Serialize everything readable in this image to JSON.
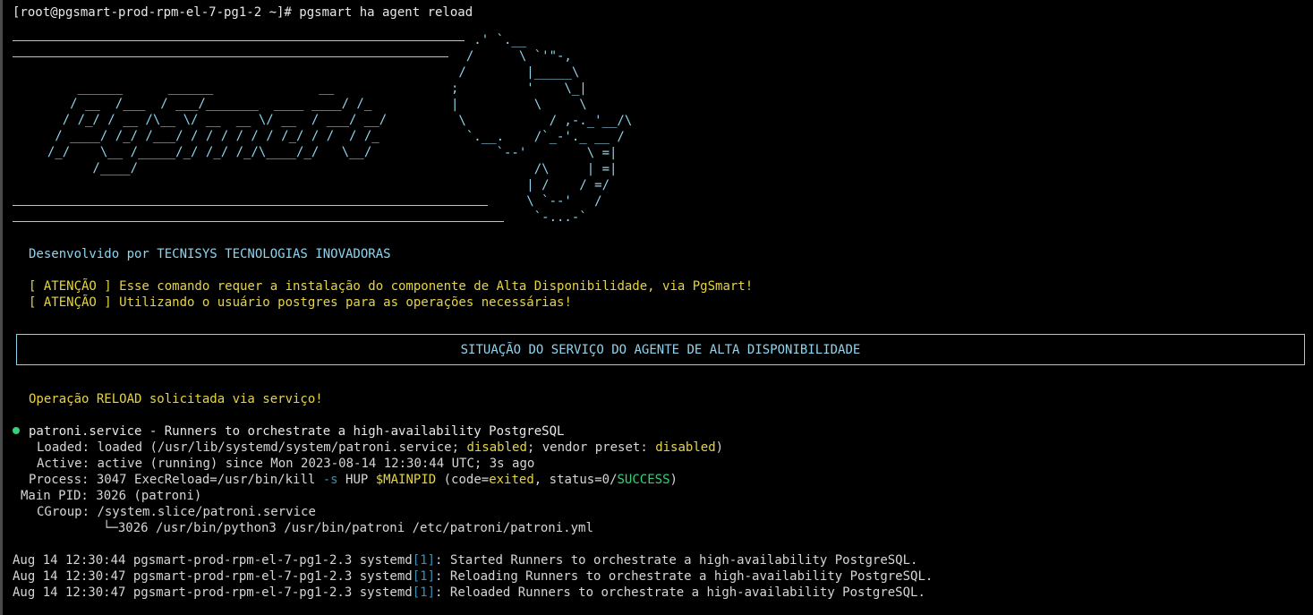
{
  "prompt": {
    "text": "[root@pgsmart-prod-rpm-el-7-pg1-2 ~]# pgsmart ha agent reload"
  },
  "banner": {
    "logo_art": "      ______      ______              __\n     / __  /___  / ___/_______  ____ ____/ /_\n    / /_/ / __ /\\__ \\/ __  __ \\/ __  / ___/ __/\n   / ____/ /_/ /___/ / / / / / / /_/ / /  / /_\n  /_/    \\__ /_____/_/ /_/ /_/\\____/_/   \\__/\n        /____/",
    "mascot_art": "   .' `.__\n  /      \\ `'\"-,\n /        |_____\\\n;         '    \\_|\n|          \\     \\\n \\           / ,-._'__/\\\n  `.__.    /`_-'._ __ /\n      `--'        \\ =|\n           /\\     | =|\n          | /    / =/\n          \\ `--'   /\n           `-...-`"
  },
  "developer_line": "Desenvolvido por TECNISYS TECNOLOGIAS INOVADORAS",
  "warnings": [
    "[ ATENÇÃO ] Esse comando requer a instalação do componente de Alta Disponibilidade, via PgSmart!",
    "[ ATENÇÃO ] Utilizando o usuário postgres para as operações necessárias!"
  ],
  "status_box": {
    "title": "SITUAÇÃO DO SERVIÇO DO AGENTE DE ALTA DISPONIBILIDADE"
  },
  "operation_line": "Operação RELOAD solicitada via serviço!",
  "service": {
    "unit": "patroni.service",
    "description": " - Runners to orchestrate a high-availability PostgreSQL",
    "loaded_label": "Loaded:",
    "loaded_pre": " loaded (/usr/lib/systemd/system/patroni.service; ",
    "loaded_state": "disabled",
    "loaded_mid": "; vendor preset: ",
    "vendor_state": "disabled",
    "loaded_post": ")",
    "active_label": "Active:",
    "active_value": " active (running) since Mon 2023-08-14 12:30:44 UTC; 3s ago",
    "process_label": "Process:",
    "process_pre": " 3047 ExecReload=/usr/bin/kill ",
    "process_flag": "-s",
    "process_mid": " HUP ",
    "process_var": "$MAINPID",
    "process_code_pre": " (code=",
    "process_code": "exited",
    "process_status_pre": ", status=0/",
    "process_status": "SUCCESS",
    "process_post": ")",
    "mainpid_label": "Main PID:",
    "mainpid_value": " 3026 (patroni)",
    "cgroup_label": "CGroup:",
    "cgroup_value": " /system.slice/patroni.service",
    "cgroup_child": "└─3026 /usr/bin/python3 /usr/bin/patroni /etc/patroni/patroni.yml"
  },
  "journal": [
    {
      "prefix": "Aug 14 12:30:44 pgsmart-prod-rpm-el-7-pg1-2.3 systemd",
      "pid": "[1]",
      "message": ": Started Runners to orchestrate a high-availability PostgreSQL."
    },
    {
      "prefix": "Aug 14 12:30:47 pgsmart-prod-rpm-el-7-pg1-2.3 systemd",
      "pid": "[1]",
      "message": ": Reloading Runners to orchestrate a high-availability PostgreSQL."
    },
    {
      "prefix": "Aug 14 12:30:47 pgsmart-prod-rpm-el-7-pg1-2.3 systemd",
      "pid": "[1]",
      "message": ": Reloaded Runners to orchestrate a high-availability PostgreSQL."
    }
  ],
  "colors": {
    "background": "#000000",
    "cyan": "#8fd4ee",
    "yellow": "#e6d444",
    "green": "#37d07a",
    "blue": "#3a8fb7"
  }
}
